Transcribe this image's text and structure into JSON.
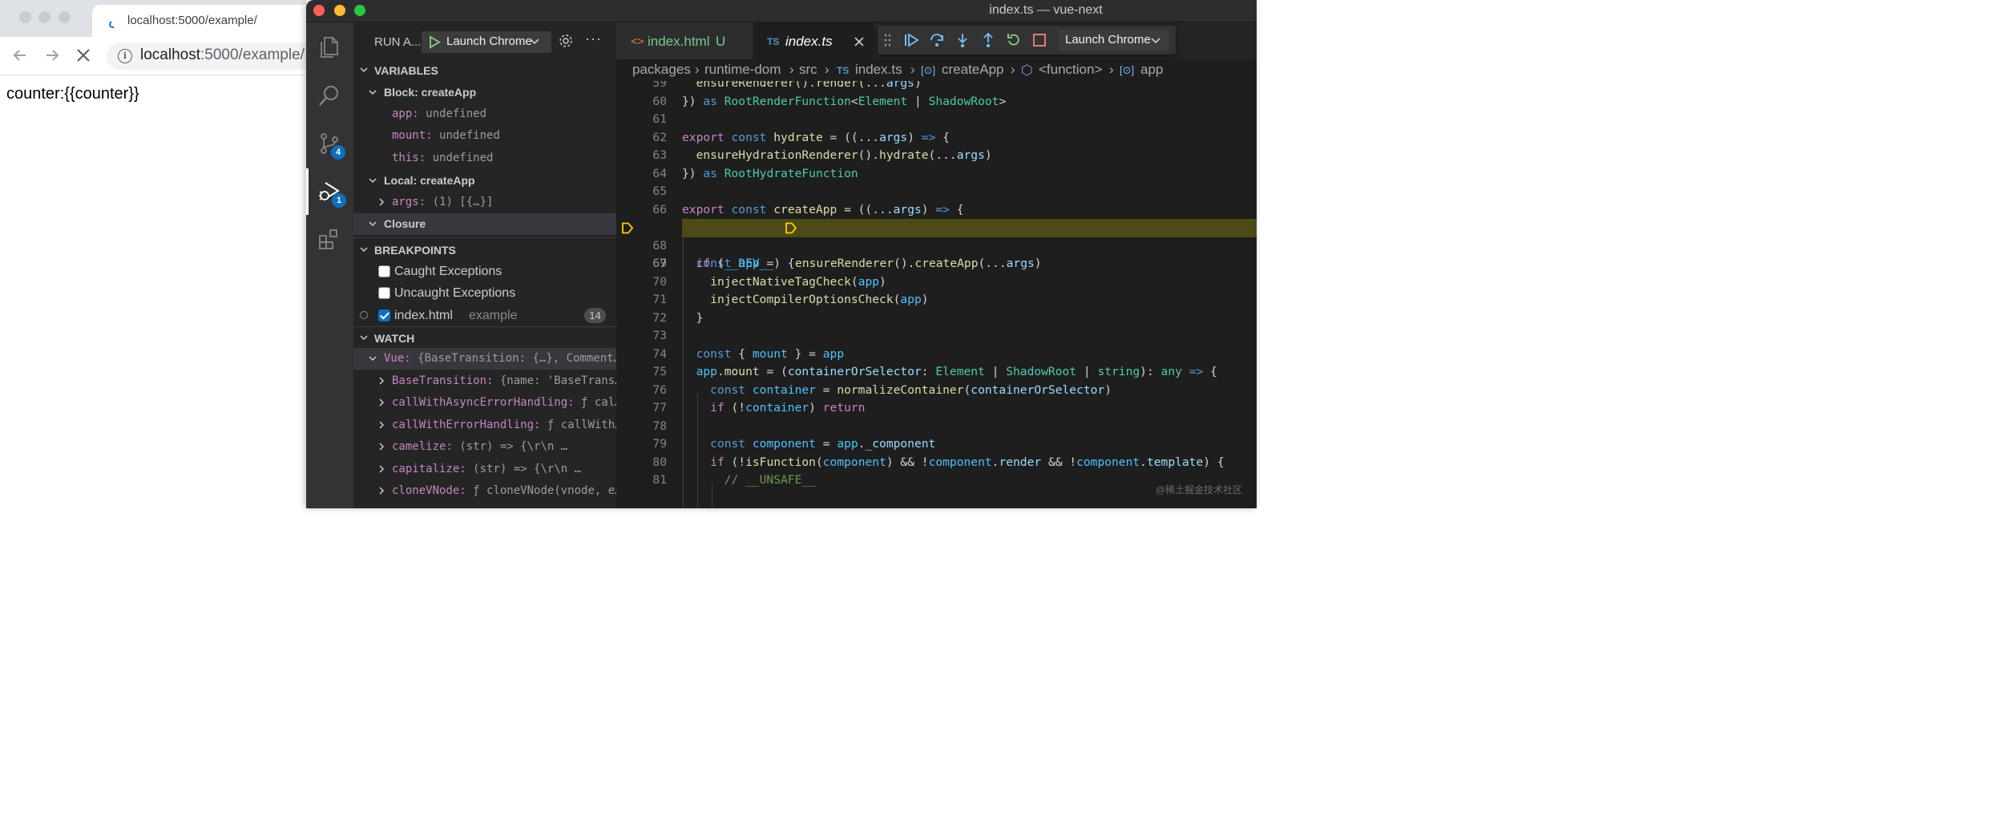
{
  "browser": {
    "tab_title": "localhost:5000/example/",
    "url_host": "localhost",
    "url_rest": ":5000/example/",
    "page_text": "counter:{{counter}}"
  },
  "vscode": {
    "window_title": "index.ts — vue-next",
    "activity": {
      "scm_badge": "4",
      "debug_badge": "1"
    },
    "sidebar": {
      "run_label": "RUN A...",
      "launch_config": "Launch Chrome",
      "variables": {
        "header": "VARIABLES",
        "block_scope": "Block: createApp",
        "block_vars": [
          {
            "name": "app:",
            "value": "undefined"
          },
          {
            "name": "mount:",
            "value": "undefined"
          },
          {
            "name": "this:",
            "value": "undefined"
          }
        ],
        "local_scope": "Local: createApp",
        "local_vars": [
          {
            "name": "args:",
            "value": "(1) [{…}]"
          }
        ],
        "closure": "Closure"
      },
      "breakpoints": {
        "header": "BREAKPOINTS",
        "items": [
          {
            "label": "Caught Exceptions",
            "checked": false
          },
          {
            "label": "Uncaught Exceptions",
            "checked": false
          },
          {
            "label": "index.html",
            "detail": "example",
            "line": "14",
            "checked": true
          }
        ]
      },
      "watch": {
        "header": "WATCH",
        "root_key": "Vue:",
        "root_value": "{BaseTransition: {…}, Comment…",
        "children": [
          {
            "name": "BaseTransition:",
            "value": "{name: 'BaseTrans…"
          },
          {
            "name": "callWithAsyncErrorHandling:",
            "value": "ƒ cal…"
          },
          {
            "name": "callWithErrorHandling:",
            "value": "ƒ callWith…"
          },
          {
            "name": "camelize:",
            "value": "(str) => {\\r\\n        …"
          },
          {
            "name": "capitalize:",
            "value": "(str) => {\\r\\n       …"
          },
          {
            "name": "cloneVNode:",
            "value": "ƒ cloneVNode(vnode, e…"
          }
        ]
      }
    },
    "editor": {
      "tabs": [
        {
          "icon": "<>",
          "label": "index.html",
          "status": "U"
        },
        {
          "icon": "TS",
          "label": "index.ts"
        }
      ],
      "debug_launch": "Launch Chrome",
      "breadcrumb": {
        "p1": "packages",
        "p2": "runtime-dom",
        "p3": "src",
        "p4": "index.ts",
        "p5": "createApp",
        "p6": "<function>",
        "p7": "app",
        "ts_icon": "TS"
      },
      "lines": [
        {
          "n": "59",
          "code": "  ensureRenderer().render(...args)"
        },
        {
          "n": "60",
          "code": "}) as RootRenderFunction<Element | ShadowRoot>"
        },
        {
          "n": "61",
          "code": ""
        },
        {
          "n": "62",
          "code": "export const hydrate = ((...args) => {"
        },
        {
          "n": "63",
          "code": "  ensureHydrationRenderer().hydrate(...args)"
        },
        {
          "n": "64",
          "code": "}) as RootHydrateFunction"
        },
        {
          "n": "65",
          "code": ""
        },
        {
          "n": "66",
          "code": "export const createApp = ((...args) => {"
        },
        {
          "n": "67",
          "code": "  const app = ensureRenderer().createApp(...args)"
        },
        {
          "n": "68",
          "code": ""
        },
        {
          "n": "69",
          "code": "  if (__DEV__) {"
        },
        {
          "n": "70",
          "code": "    injectNativeTagCheck(app)"
        },
        {
          "n": "71",
          "code": "    injectCompilerOptionsCheck(app)"
        },
        {
          "n": "72",
          "code": "  }"
        },
        {
          "n": "73",
          "code": ""
        },
        {
          "n": "74",
          "code": "  const { mount } = app"
        },
        {
          "n": "75",
          "code": "  app.mount = (containerOrSelector: Element | ShadowRoot | string): any => {"
        },
        {
          "n": "76",
          "code": "    const container = normalizeContainer(containerOrSelector)"
        },
        {
          "n": "77",
          "code": "    if (!container) return"
        },
        {
          "n": "78",
          "code": ""
        },
        {
          "n": "79",
          "code": "    const component = app._component"
        },
        {
          "n": "80",
          "code": "    if (!isFunction(component) && !component.render && !component.template) {"
        },
        {
          "n": "81",
          "code": "      // __UNSAFE__"
        }
      ],
      "current_line": "67"
    },
    "watermark": "@稀土掘金技术社区"
  },
  "colors": {
    "accent": "#0e70c0",
    "highlight_line": "#4b4b18",
    "breakpoint_arrow": "#ffcc00"
  }
}
